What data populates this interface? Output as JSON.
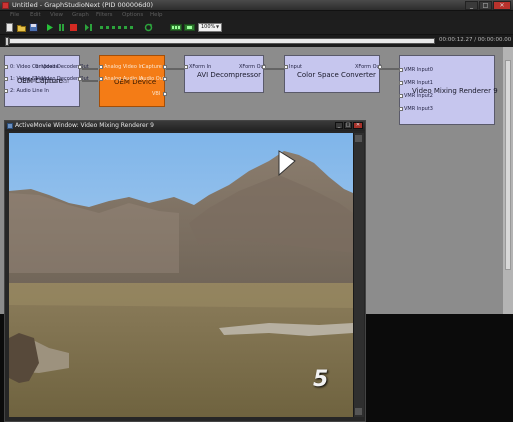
{
  "window": {
    "title": "Untitled - GraphStudioNext (PID 000006d0)",
    "min_glyph": "_",
    "max_glyph": "□",
    "close_glyph": "✕"
  },
  "menu": [
    "File",
    "Edit",
    "View",
    "Graph",
    "Filters",
    "Options",
    "Help"
  ],
  "toolbar": {
    "zoom_value": "100%",
    "zoom_arrow": "▼",
    "icons": [
      "new-icon",
      "open-icon",
      "save-icon",
      "play-icon",
      "pause-icon",
      "stop-icon",
      "step-icon",
      "refresh-icon",
      "seek-icon",
      "fullscreen-icon"
    ]
  },
  "seek": {
    "time": "00:00:12.27 / 00:00:00.00",
    "progress": 0
  },
  "graph": {
    "filters": [
      {
        "name": "OEM Capture",
        "name_overlay": "OEM Crossbar",
        "color": "#c6c6ee",
        "inputs": [
          "0: Video Composite",
          "1: Video SVideo",
          "2: Audio Line In"
        ],
        "outputs": [
          "0: Video Decoder Out",
          "1: Video Decoder Out"
        ]
      },
      {
        "name": "OEM Device",
        "color": "#f47c16",
        "inputs": [
          "Analog Video In",
          "Analog Audio In"
        ],
        "outputs": [
          "Capture",
          "Audio Out",
          "VBI"
        ]
      },
      {
        "name": "AVI Decompressor",
        "color": "#c6c6ee",
        "inputs": [
          "XForm In"
        ],
        "outputs": [
          "XForm Out"
        ]
      },
      {
        "name": "Color Space Converter",
        "color": "#c6c6ee",
        "inputs": [
          "Input"
        ],
        "outputs": [
          "XForm Out"
        ]
      },
      {
        "name": "Video Mixing Renderer 9",
        "color": "#c6c6ee",
        "inputs": [
          "VMR Input0",
          "VMR Input1",
          "VMR Input2",
          "VMR Input3"
        ],
        "outputs": []
      }
    ]
  },
  "video_window": {
    "title": "ActiveMovie Window: Video Mixing Renderer 9",
    "channel_logo": "5",
    "min_glyph": "_",
    "max_glyph": "□",
    "close_glyph": "✕"
  }
}
